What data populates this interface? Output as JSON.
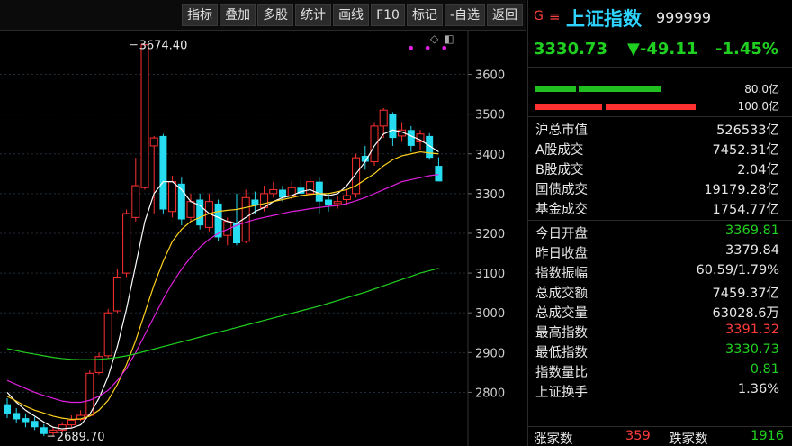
{
  "toolbar": {
    "buttons": [
      "指标",
      "叠加",
      "多股",
      "统计",
      "画线",
      "F10",
      "标记",
      "-自选",
      "返回"
    ]
  },
  "header": {
    "g_label": "G",
    "menu_glyph": "≡",
    "name": "上证指数",
    "code": "999999"
  },
  "quote": {
    "price": "3330.73",
    "change": "▼-49.11",
    "pct": "-1.45%"
  },
  "volume_bars": {
    "top_label": "80.0亿",
    "bottom_label": "100.0亿",
    "top_color": "#20c020",
    "bottom_color": "#ff3030",
    "top_fill": 0.5,
    "bottom_fill": 0.6
  },
  "stats_top": [
    {
      "key": "沪总市值",
      "value": "526533亿",
      "tone": ""
    },
    {
      "key": "A股成交",
      "value": "7452.31亿",
      "tone": ""
    },
    {
      "key": "B股成交",
      "value": "2.04亿",
      "tone": ""
    },
    {
      "key": "国债成交",
      "value": "19179.28亿",
      "tone": ""
    },
    {
      "key": "基金成交",
      "value": "1754.77亿",
      "tone": ""
    }
  ],
  "stats_bottom": [
    {
      "key": "今日开盘",
      "value": "3369.81",
      "tone": "dn"
    },
    {
      "key": "昨日收盘",
      "value": "3379.84",
      "tone": ""
    },
    {
      "key": "指数振幅",
      "value": "60.59/1.79%",
      "tone": ""
    },
    {
      "key": "总成交额",
      "value": "7459.37亿",
      "tone": ""
    },
    {
      "key": "总成交量",
      "value": "63028.6万",
      "tone": ""
    },
    {
      "key": "最高指数",
      "value": "3391.32",
      "tone": "up"
    },
    {
      "key": "最低指数",
      "value": "3330.73",
      "tone": "dn"
    },
    {
      "key": "指数量比",
      "value": "0.81",
      "tone": "dn"
    },
    {
      "key": "上证换手",
      "value": "1.36%",
      "tone": ""
    }
  ],
  "footer": {
    "up_label": "涨家数",
    "up_count": "359",
    "down_label": "跌家数",
    "down_count": "1916"
  },
  "chart_data": {
    "type": "candlestick",
    "y_ticks": [
      2800,
      2900,
      3000,
      3100,
      3200,
      3300,
      3400,
      3500,
      3600
    ],
    "ylim": [
      2665,
      3710
    ],
    "annotations": [
      {
        "label": "3674.40",
        "at_index": 13,
        "value": 3674.4
      },
      {
        "label": "2689.70",
        "at_index": 4,
        "value": 2689.7
      }
    ],
    "candles": [
      [
        2770,
        2745,
        2785,
        2735
      ],
      [
        2748,
        2732,
        2760,
        2722
      ],
      [
        2735,
        2725,
        2745,
        2712
      ],
      [
        2728,
        2712,
        2738,
        2705
      ],
      [
        2712,
        2695,
        2720,
        2689.7
      ],
      [
        2698,
        2705,
        2712,
        2690
      ],
      [
        2705,
        2718,
        2725,
        2700
      ],
      [
        2718,
        2730,
        2742,
        2712
      ],
      [
        2732,
        2742,
        2755,
        2728
      ],
      [
        2742,
        2848,
        2855,
        2740
      ],
      [
        2850,
        2890,
        2900,
        2845
      ],
      [
        2892,
        3000,
        3010,
        2885
      ],
      [
        3005,
        3090,
        3110,
        3000
      ],
      [
        3100,
        3250,
        3260,
        3090
      ],
      [
        3240,
        3320,
        3390,
        3230
      ],
      [
        3315,
        3674.4,
        3674.4,
        3310
      ],
      [
        3420,
        3440,
        3445,
        3250
      ],
      [
        3445,
        3260,
        3450,
        3250
      ],
      [
        3255,
        3330,
        3345,
        3240
      ],
      [
        3325,
        3235,
        3340,
        3220
      ],
      [
        3240,
        3280,
        3300,
        3230
      ],
      [
        3285,
        3220,
        3300,
        3210
      ],
      [
        3215,
        3280,
        3300,
        3205
      ],
      [
        3275,
        3190,
        3285,
        3180
      ],
      [
        3195,
        3230,
        3240,
        3170
      ],
      [
        3225,
        3175,
        3300,
        3170
      ],
      [
        3180,
        3290,
        3310,
        3175
      ],
      [
        3285,
        3270,
        3305,
        3250
      ],
      [
        3265,
        3300,
        3320,
        3255
      ],
      [
        3300,
        3310,
        3330,
        3290
      ],
      [
        3310,
        3290,
        3320,
        3280
      ],
      [
        3295,
        3315,
        3330,
        3285
      ],
      [
        3315,
        3300,
        3335,
        3290
      ],
      [
        3300,
        3330,
        3345,
        3295
      ],
      [
        3330,
        3280,
        3340,
        3250
      ],
      [
        3285,
        3270,
        3300,
        3255
      ],
      [
        3275,
        3280,
        3295,
        3262
      ],
      [
        3285,
        3295,
        3310,
        3270
      ],
      [
        3300,
        3390,
        3400,
        3290
      ],
      [
        3395,
        3380,
        3420,
        3360
      ],
      [
        3380,
        3470,
        3480,
        3370
      ],
      [
        3470,
        3510,
        3515,
        3440
      ],
      [
        3500,
        3440,
        3505,
        3420
      ],
      [
        3445,
        3460,
        3480,
        3430
      ],
      [
        3460,
        3420,
        3470,
        3405
      ],
      [
        3430,
        3450,
        3460,
        3410
      ],
      [
        3445,
        3390,
        3452,
        3385
      ],
      [
        3369.81,
        3330.73,
        3391.32,
        3330.73
      ]
    ],
    "ma_series": [
      {
        "color": "#ffffff",
        "values": [
          2800,
          2775,
          2755,
          2740,
          2725,
          2712,
          2708,
          2710,
          2718,
          2745,
          2785,
          2840,
          2915,
          3010,
          3120,
          3230,
          3300,
          3330,
          3330,
          3310,
          3280,
          3270,
          3250,
          3240,
          3230,
          3225,
          3240,
          3255,
          3265,
          3280,
          3290,
          3295,
          3305,
          3310,
          3300,
          3295,
          3300,
          3320,
          3350,
          3380,
          3420,
          3450,
          3460,
          3455,
          3445,
          3435,
          3420,
          3405
        ]
      },
      {
        "color": "#ffd21e",
        "values": [
          2790,
          2778,
          2765,
          2755,
          2748,
          2740,
          2735,
          2732,
          2733,
          2740,
          2755,
          2780,
          2820,
          2870,
          2930,
          3000,
          3070,
          3130,
          3180,
          3210,
          3230,
          3240,
          3250,
          3255,
          3258,
          3260,
          3265,
          3270,
          3275,
          3280,
          3285,
          3290,
          3295,
          3298,
          3300,
          3300,
          3305,
          3310,
          3320,
          3335,
          3350,
          3370,
          3385,
          3395,
          3400,
          3405,
          3402,
          3400
        ]
      },
      {
        "color": "#e020e0",
        "values": [
          2830,
          2820,
          2810,
          2800,
          2792,
          2785,
          2778,
          2775,
          2775,
          2780,
          2790,
          2805,
          2830,
          2860,
          2900,
          2945,
          2990,
          3035,
          3075,
          3110,
          3140,
          3165,
          3185,
          3200,
          3210,
          3220,
          3228,
          3235,
          3240,
          3245,
          3250,
          3255,
          3258,
          3262,
          3265,
          3268,
          3270,
          3275,
          3282,
          3290,
          3300,
          3310,
          3320,
          3330,
          3335,
          3340,
          3345,
          3348
        ]
      },
      {
        "color": "#20d020",
        "values": [
          2910,
          2905,
          2900,
          2896,
          2892,
          2888,
          2885,
          2883,
          2882,
          2882,
          2883,
          2885,
          2888,
          2892,
          2897,
          2903,
          2909,
          2915,
          2921,
          2927,
          2933,
          2939,
          2945,
          2951,
          2957,
          2963,
          2969,
          2975,
          2981,
          2987,
          2993,
          2999,
          3005,
          3011,
          3017,
          3024,
          3031,
          3038,
          3045,
          3052,
          3060,
          3068,
          3076,
          3084,
          3092,
          3100,
          3106,
          3112
        ]
      }
    ]
  }
}
